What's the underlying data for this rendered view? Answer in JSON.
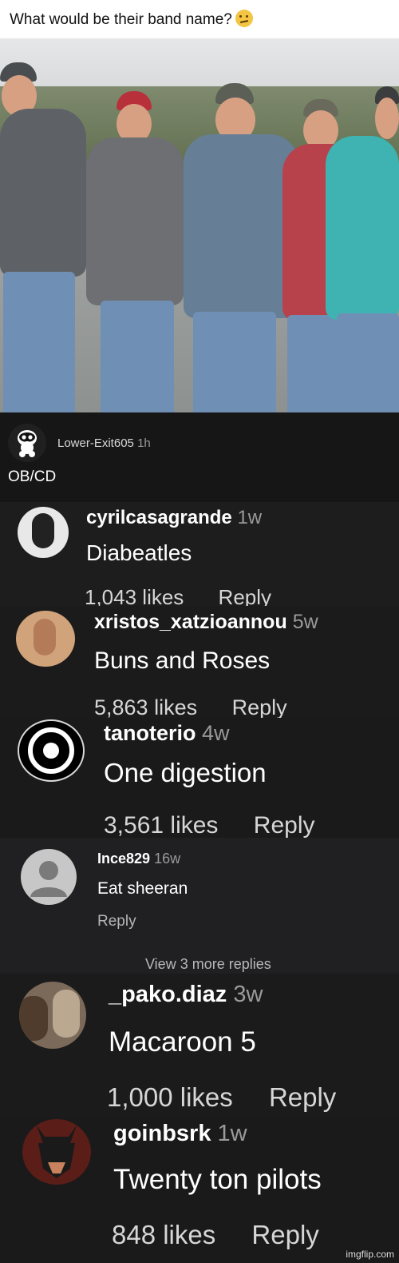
{
  "post": {
    "title": "What would be their band name?",
    "emoji": "thinking-face-icon"
  },
  "top_comment": {
    "username": "Lower-Exit605",
    "age": "1h",
    "text": "OB/CD"
  },
  "comments": [
    {
      "username": "cyrilcasagrande",
      "age": "1w",
      "text": "Diabeatles",
      "likes": "1,043 likes",
      "reply": "Reply"
    },
    {
      "username": "xristos_xatzioannou",
      "age": "5w",
      "text": "Buns and Roses",
      "likes": "5,863 likes",
      "reply": "Reply"
    },
    {
      "username": "tanoterio",
      "age": "4w",
      "text": "One digestion",
      "likes": "3,561 likes",
      "reply": "Reply"
    },
    {
      "username": "Ince829",
      "age": "16w",
      "text": "Eat sheeran",
      "reply": "Reply",
      "view_more": "View 3 more replies"
    },
    {
      "username": "_pako.diaz",
      "age": "3w",
      "text": "Macaroon 5",
      "likes": "1,000 likes",
      "reply": "Reply"
    },
    {
      "username": "goinbsrk",
      "age": "1w",
      "text": "Twenty ton pilots",
      "likes": "848 likes",
      "reply": "Reply"
    }
  ],
  "watermark": "imgflip.com",
  "colors": {
    "background": "#1c1c1c",
    "header": "#ffffff",
    "text": "#ffffff",
    "muted": "#9a9a9a"
  }
}
